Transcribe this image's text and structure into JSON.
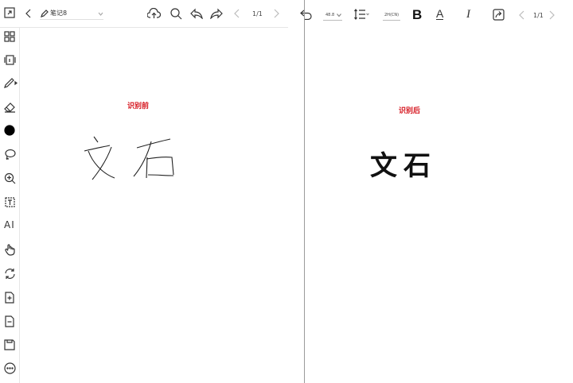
{
  "left": {
    "notebook_title": "笔记8",
    "page_indicator": "1/1",
    "before_label": "识别前",
    "sidebar": {
      "ai_label": "AI"
    }
  },
  "right": {
    "font_size": "48.8",
    "spacing_value": "2H(CN)",
    "page_indicator": "1/1",
    "after_label": "识别后",
    "recognized_text": "文石"
  }
}
